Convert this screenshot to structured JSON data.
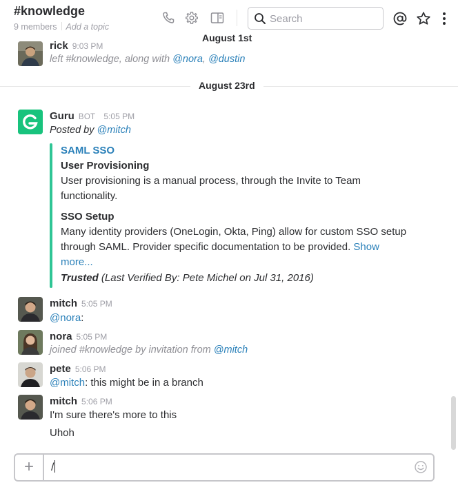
{
  "header": {
    "channel_name": "#knowledge",
    "members": "9 members",
    "add_topic": "Add a topic",
    "search_placeholder": "Search"
  },
  "icons": [
    "phone-icon",
    "gear-icon",
    "sidebar-toggle-icon",
    "search-icon",
    "mention-icon",
    "star-icon",
    "more-icon",
    "plus-icon",
    "emoji-icon"
  ],
  "colors": {
    "link": "#2a80b9",
    "accent_bar": "#2fc595",
    "guru_green": "#18c37d"
  },
  "days": [
    "August 1st",
    "August 23rd"
  ],
  "messages": [
    {
      "user": "rick",
      "time": "9:03 PM",
      "system_prefix": "left #knowledge, along with ",
      "mention1": "@nora",
      "comma": ", ",
      "mention2": "@dustin"
    },
    {
      "user": "Guru",
      "tag": "BOT",
      "time": "5:05 PM",
      "posted_by_prefix": "Posted by ",
      "posted_by_mention": "@mitch"
    },
    {
      "user": "mitch",
      "time": "5:05 PM",
      "mention": "@nora",
      "text_suffix": ":"
    },
    {
      "user": "nora",
      "time": "5:05 PM",
      "system_prefix": "joined #knowledge by invitation from ",
      "mention": "@mitch"
    },
    {
      "user": "pete",
      "time": "5:06 PM",
      "mention": "@mitch",
      "text_suffix": ": this might be in a branch"
    },
    {
      "user": "mitch",
      "time": "5:06 PM",
      "line1": "I'm sure there's more to this",
      "line2": "Uhoh"
    }
  ],
  "attachment": {
    "title": "SAML SSO",
    "heading1": "User Provisioning",
    "body1_line1": "User provisioning is a manual process, through the Invite to Team",
    "body1_line2": "functionality.",
    "heading2": "SSO Setup",
    "body2_line1": "Many identity providers (OneLogin, Okta, Ping) allow for custom SSO setup",
    "body2_line2": "through SAML.  Provider specific documentation to be provided. ",
    "show_more_1": "Show",
    "show_more_2": "more...",
    "trusted": "Trusted",
    "verified": " (Last Verified By: Pete Michel on Jul 31, 2016)"
  },
  "composer": {
    "value": "/"
  }
}
